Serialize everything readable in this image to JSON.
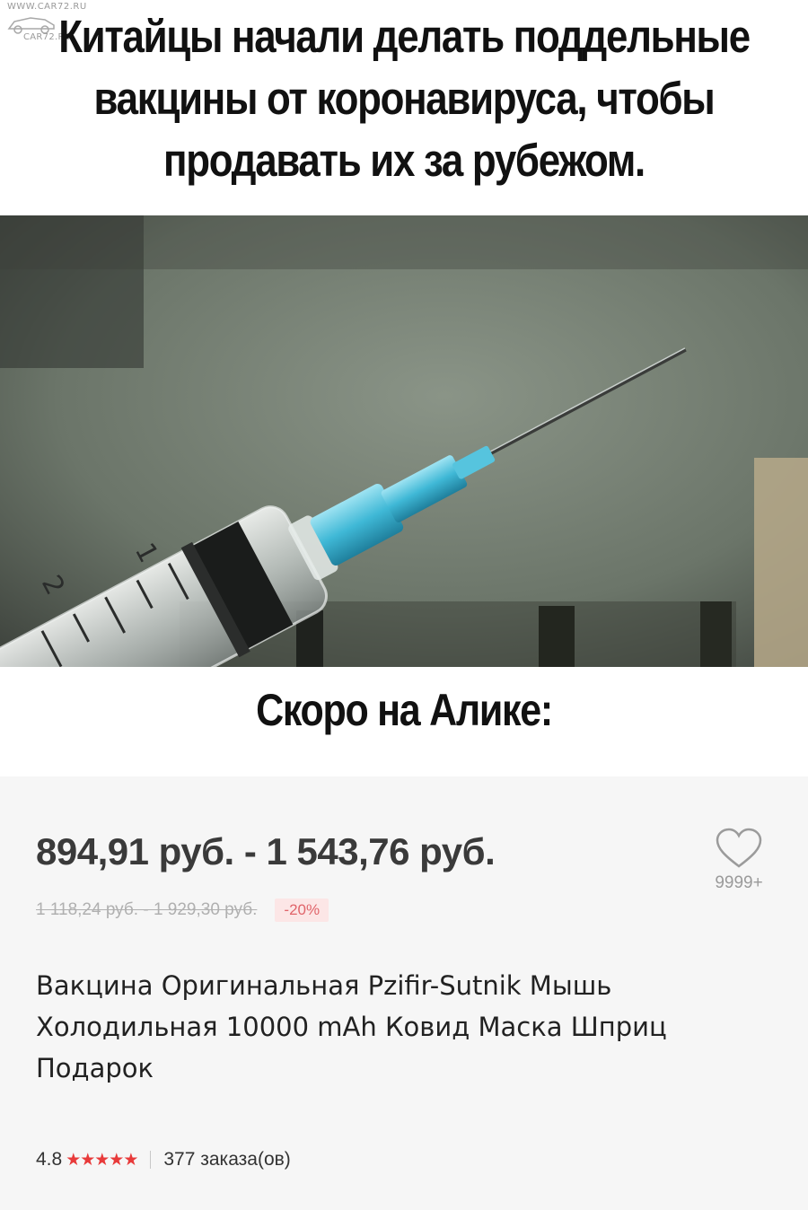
{
  "watermark": {
    "top": "WWW.CAR72.RU",
    "bottom": "CAR72.RU"
  },
  "headline": {
    "lines": [
      "Китайцы начали делать поддельные",
      "вакцины от коронавируса, чтобы",
      "продавать их за рубежом."
    ]
  },
  "photo": {
    "syringe_marks": [
      "1",
      "2"
    ]
  },
  "subheading": "Скоро на Алике:",
  "product": {
    "price_range": "894,91 руб. - 1 543,76 руб.",
    "old_price_range": "1 118,24 руб. - 1 929,30 руб.",
    "discount": "-20%",
    "wishlist_count": "9999+",
    "title_lines": [
      "Вакцина Оригинальная Pzifir-Sutnik Мышь",
      "Холодильная 10000 mAh Ковид Маска Шприц",
      "Подарок"
    ],
    "rating": "4.8",
    "rating_stars": 5,
    "stars_text": "★★★★★",
    "orders": "377 заказа(ов)"
  },
  "colors": {
    "accent_red": "#e83a3a",
    "badge_bg": "#fce6e6",
    "panel_bg": "#f6f6f6"
  },
  "icons": {
    "wishlist": "heart-icon",
    "rating": "star-icon"
  }
}
